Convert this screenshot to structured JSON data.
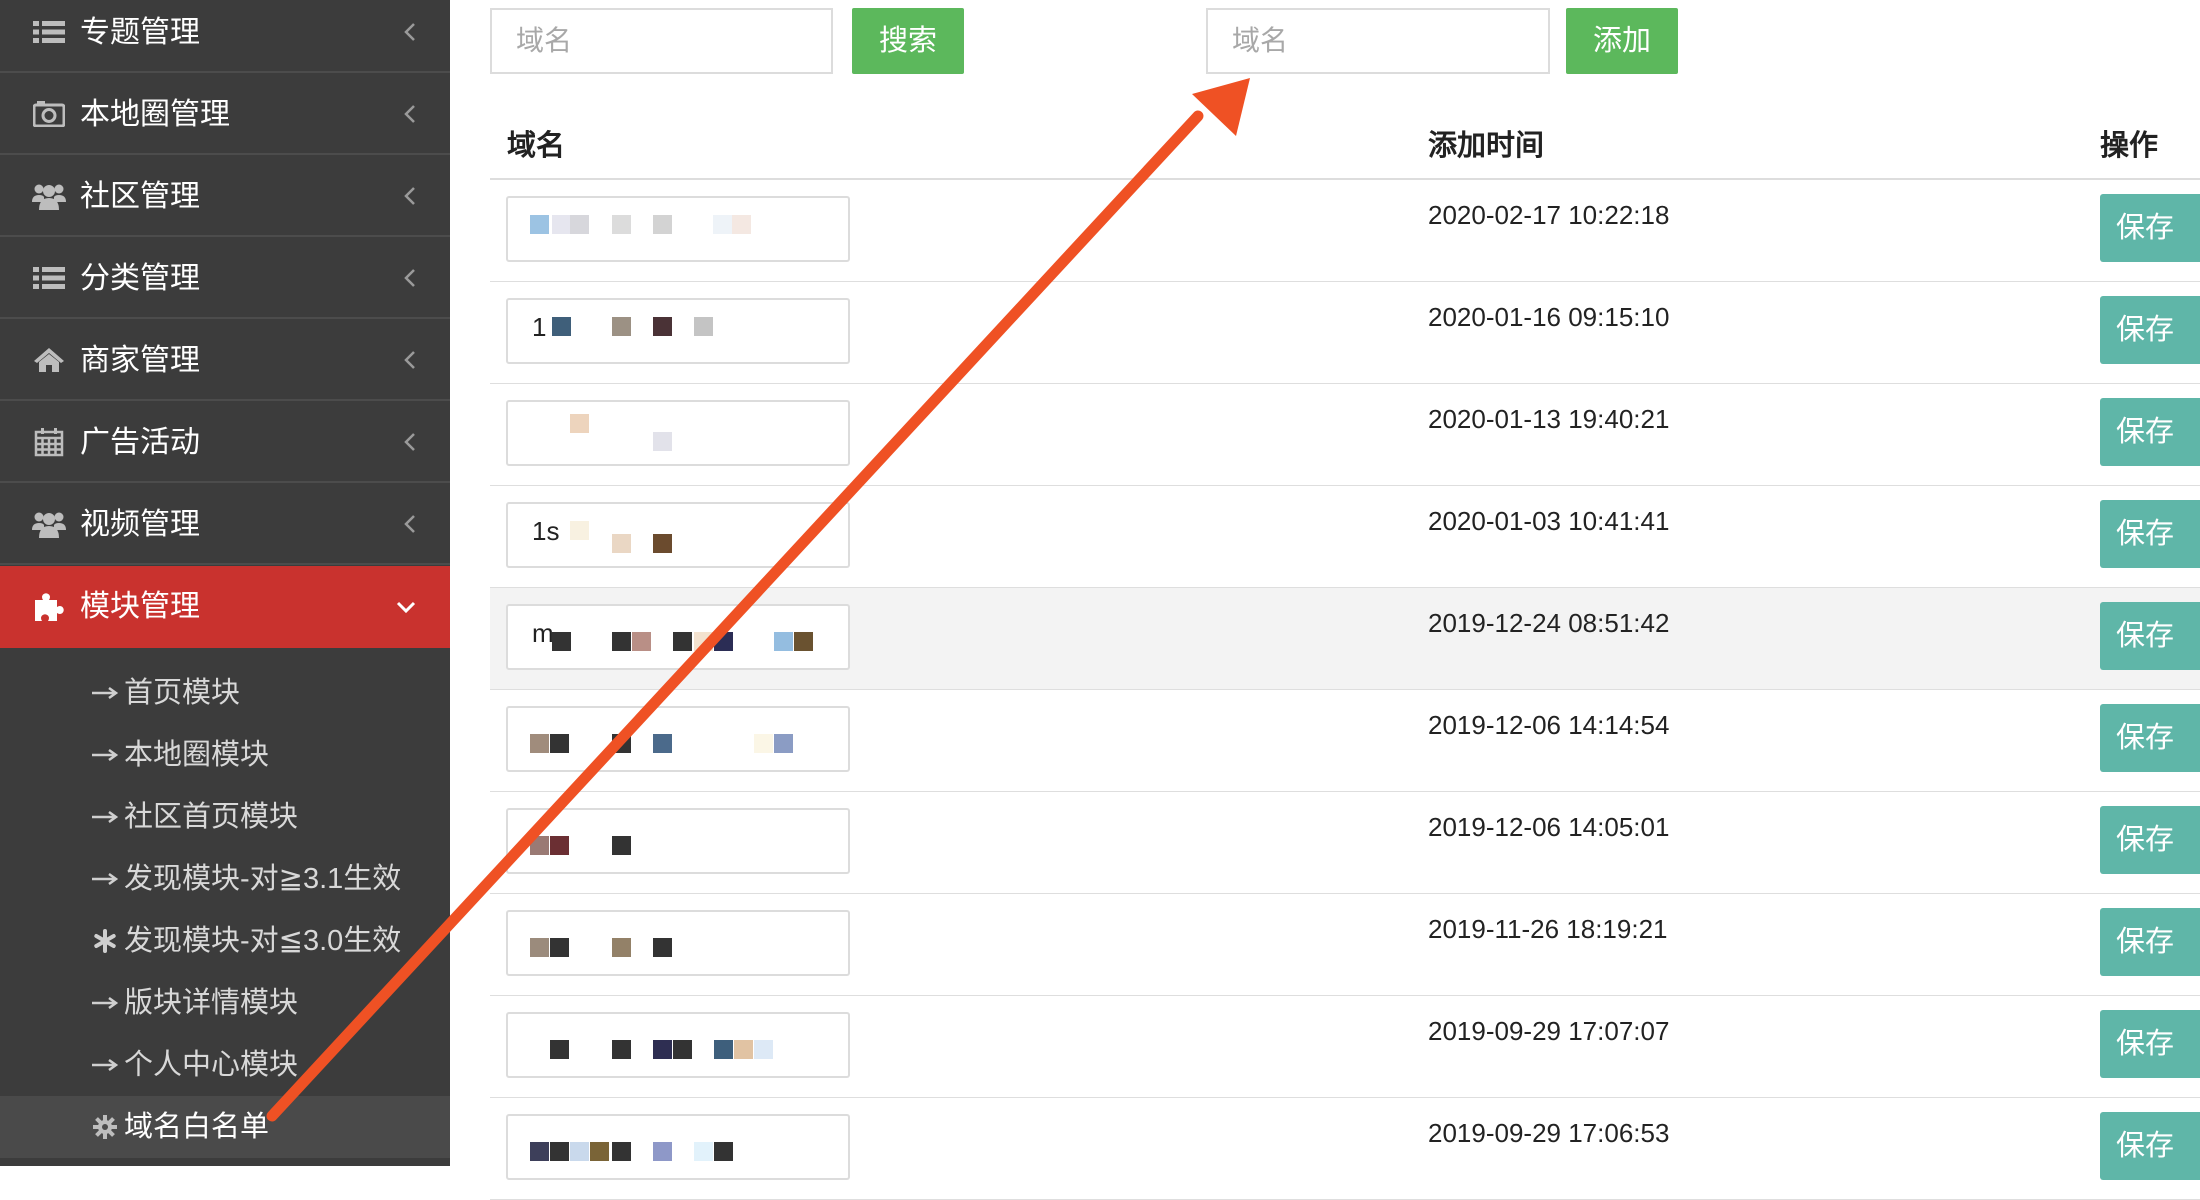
{
  "sidebar": {
    "menu": [
      {
        "label": "专题管理",
        "icon": "list-icon"
      },
      {
        "label": "本地圈管理",
        "icon": "camera-icon"
      },
      {
        "label": "社区管理",
        "icon": "users-icon"
      },
      {
        "label": "分类管理",
        "icon": "list-icon"
      },
      {
        "label": "商家管理",
        "icon": "home-icon"
      },
      {
        "label": "广告活动",
        "icon": "calendar-icon"
      },
      {
        "label": "视频管理",
        "icon": "users-icon"
      },
      {
        "label": "模块管理",
        "icon": "puzzle-icon",
        "active": true
      }
    ],
    "submenu": [
      {
        "label": "首页模块",
        "icon": "arrow-right-icon"
      },
      {
        "label": "本地圈模块",
        "icon": "arrow-right-icon"
      },
      {
        "label": "社区首页模块",
        "icon": "arrow-right-icon"
      },
      {
        "label": "发现模块-对≧3.1生效",
        "icon": "arrow-right-icon"
      },
      {
        "label": "发现模块-对≦3.0生效",
        "icon": "asterisk-icon"
      },
      {
        "label": "版块详情模块",
        "icon": "arrow-right-icon"
      },
      {
        "label": "个人中心模块",
        "icon": "arrow-right-icon"
      },
      {
        "label": "域名白名单",
        "icon": "gear-icon",
        "current": true
      }
    ]
  },
  "toolbar": {
    "search_placeholder": "域名",
    "search_label": "搜索",
    "add_placeholder": "域名",
    "add_label": "添加"
  },
  "table": {
    "headers": {
      "domain": "域名",
      "time": "添加时间",
      "action": "操作"
    },
    "save_label": "保存",
    "rows": [
      {
        "time": "2020-02-17 10:22:18",
        "fragment": ""
      },
      {
        "time": "2020-01-16 09:15:10",
        "fragment": "1"
      },
      {
        "time": "2020-01-13 19:40:21",
        "fragment": ""
      },
      {
        "time": "2020-01-03 10:41:41",
        "fragment": "1s"
      },
      {
        "time": "2019-12-24 08:51:42",
        "fragment": "m"
      },
      {
        "time": "2019-12-06 14:14:54",
        "fragment": ""
      },
      {
        "time": "2019-12-06 14:05:01",
        "fragment": ""
      },
      {
        "time": "2019-11-26 18:19:21",
        "fragment": ""
      },
      {
        "time": "2019-09-29 17:07:07",
        "fragment": ""
      },
      {
        "time": "2019-09-29 17:06:53",
        "fragment": ""
      }
    ]
  },
  "colors": {
    "sidebar_bg": "#3c3c3c",
    "active_red": "#c9322e",
    "green_button": "#5cb85c",
    "teal_button": "#5fb6a8",
    "annotation_arrow": "#ef5124"
  }
}
